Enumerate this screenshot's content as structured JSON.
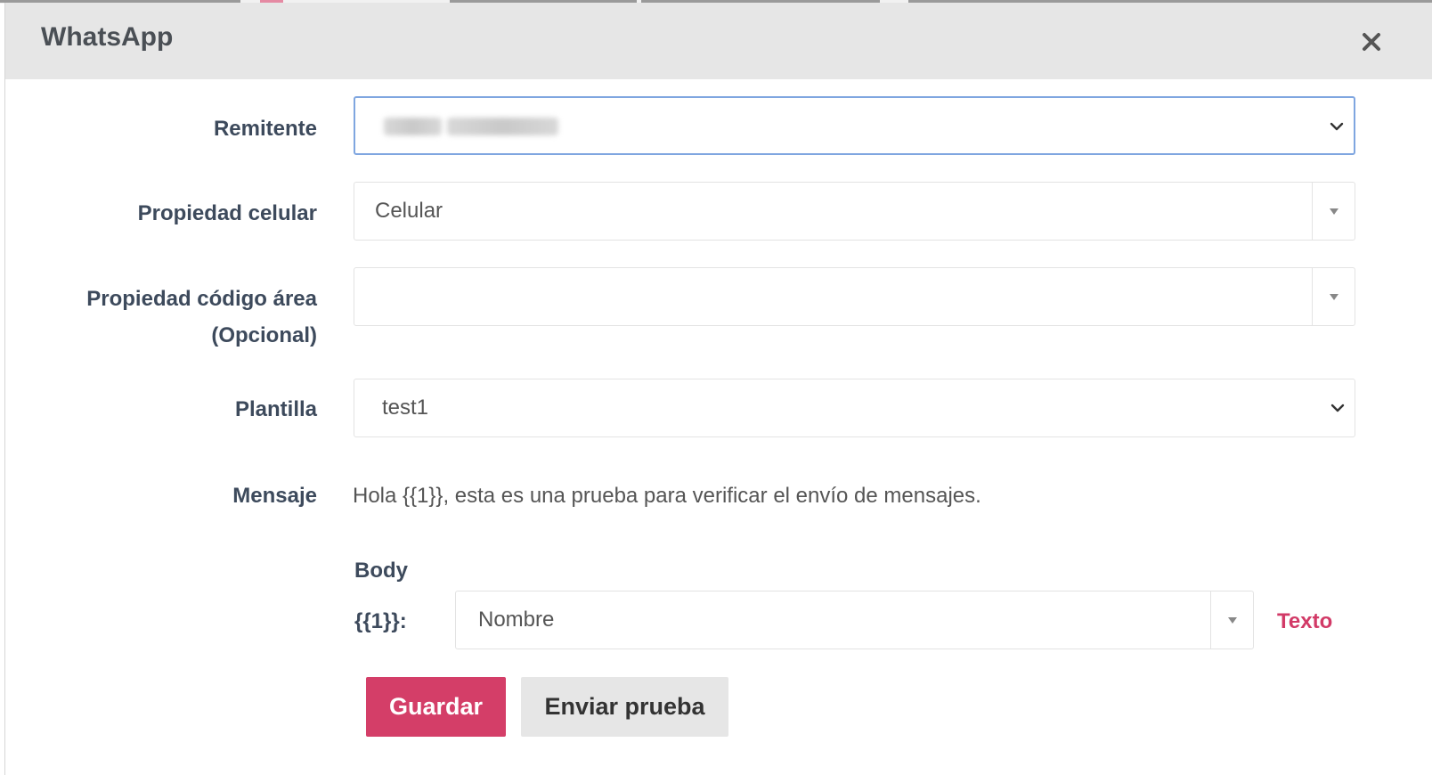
{
  "modal": {
    "title": "WhatsApp"
  },
  "form": {
    "sender": {
      "label": "Remitente",
      "value": ""
    },
    "phone_property": {
      "label": "Propiedad celular",
      "value": "Celular"
    },
    "area_code_property": {
      "label_line1": "Propiedad código área",
      "label_line2": "(Opcional)",
      "value": ""
    },
    "template": {
      "label": "Plantilla",
      "value": "test1"
    },
    "message": {
      "label": "Mensaje",
      "text": "Hola {{1}}, esta es una prueba para verificar el envío de mensajes."
    },
    "body": {
      "title": "Body",
      "variables": [
        {
          "placeholder": "{{1}}:",
          "value": "Nombre",
          "toggle_label": "Texto"
        }
      ]
    }
  },
  "actions": {
    "save_label": "Guardar",
    "test_label": "Enviar prueba"
  },
  "colors": {
    "accent": "#d43e68",
    "link": "#d23a67",
    "focus_border": "#7fa6e0",
    "header_bg": "#e6e6e6"
  }
}
